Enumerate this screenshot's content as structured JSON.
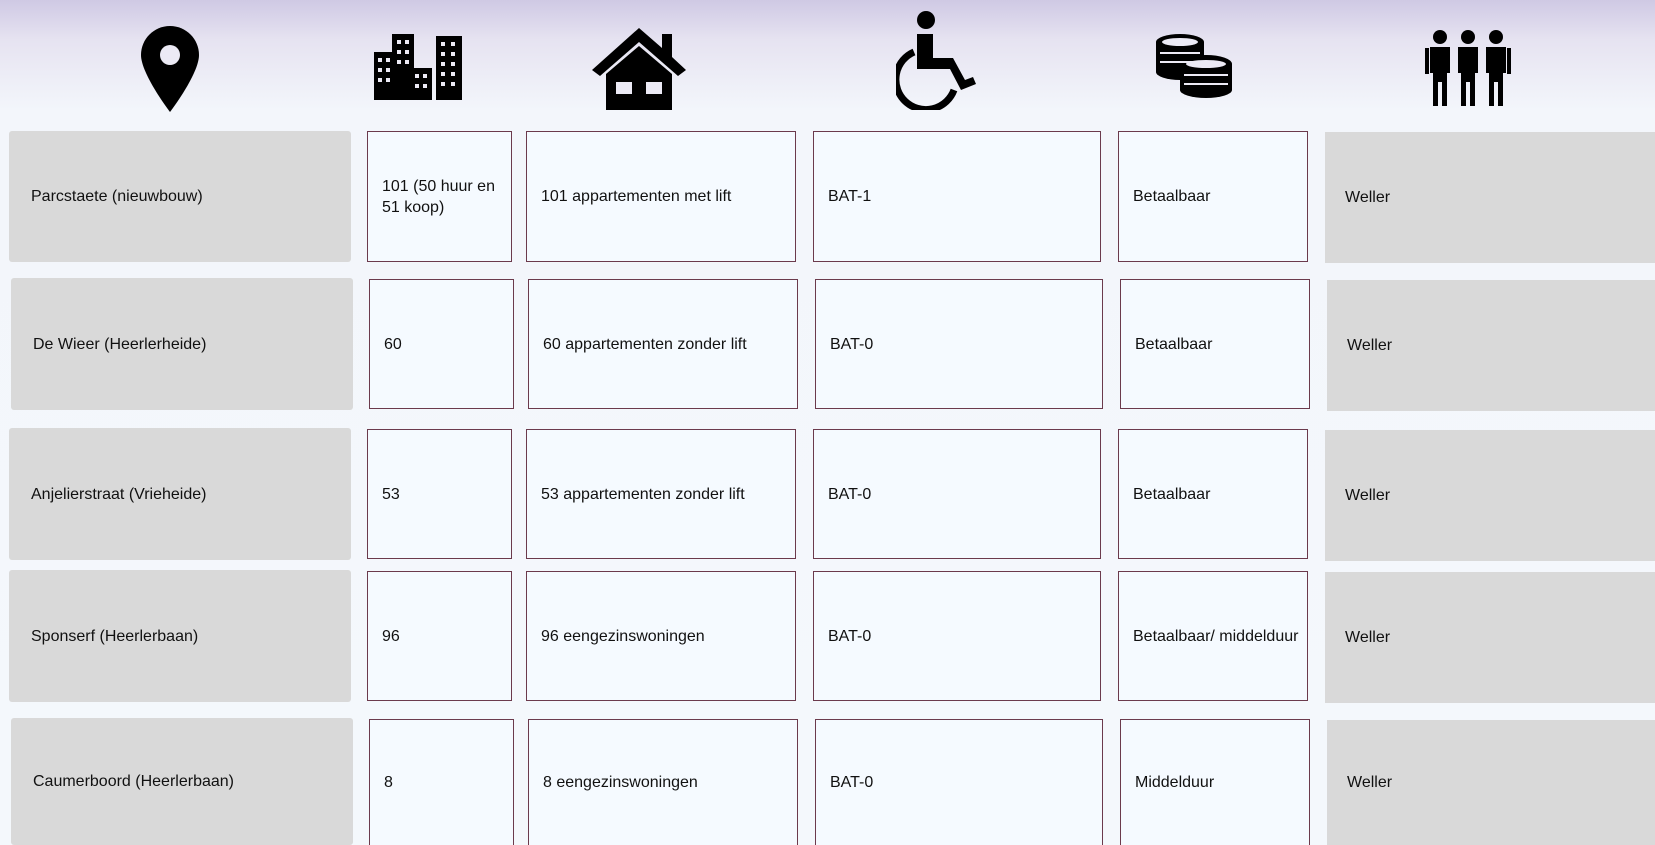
{
  "header_icons": [
    "location-pin-icon",
    "buildings-icon",
    "house-icon",
    "wheelchair-icon",
    "coins-icon",
    "people-icon"
  ],
  "rows": [
    {
      "location": "Parcstaete (nieuwbouw)",
      "units": "101 (50 huur en 51 koop)",
      "type": "101 appartementen met lift",
      "accessibility": "BAT-1",
      "price": "Betaalbaar",
      "owner": "Weller"
    },
    {
      "location": "De Wieer (Heerlerheide)",
      "units": "60",
      "type": "60 appartementen zonder lift",
      "accessibility": "BAT-0",
      "price": "Betaalbaar",
      "owner": "Weller"
    },
    {
      "location": "Anjelierstraat (Vrieheide)",
      "units": "53",
      "type": "53 appartementen zonder lift",
      "accessibility": "BAT-0",
      "price": "Betaalbaar",
      "owner": "Weller"
    },
    {
      "location": "Sponserf (Heerlerbaan)",
      "units": "96",
      "type": "96 eengezinswoningen",
      "accessibility": "BAT-0",
      "price": "Betaalbaar/ middelduur",
      "owner": "Weller"
    },
    {
      "location": "Caumerboord (Heerlerbaan)",
      "units": "8",
      "type": "8 eengezinswoningen",
      "accessibility": "BAT-0",
      "price": "Middelduur",
      "owner": "Weller"
    }
  ]
}
